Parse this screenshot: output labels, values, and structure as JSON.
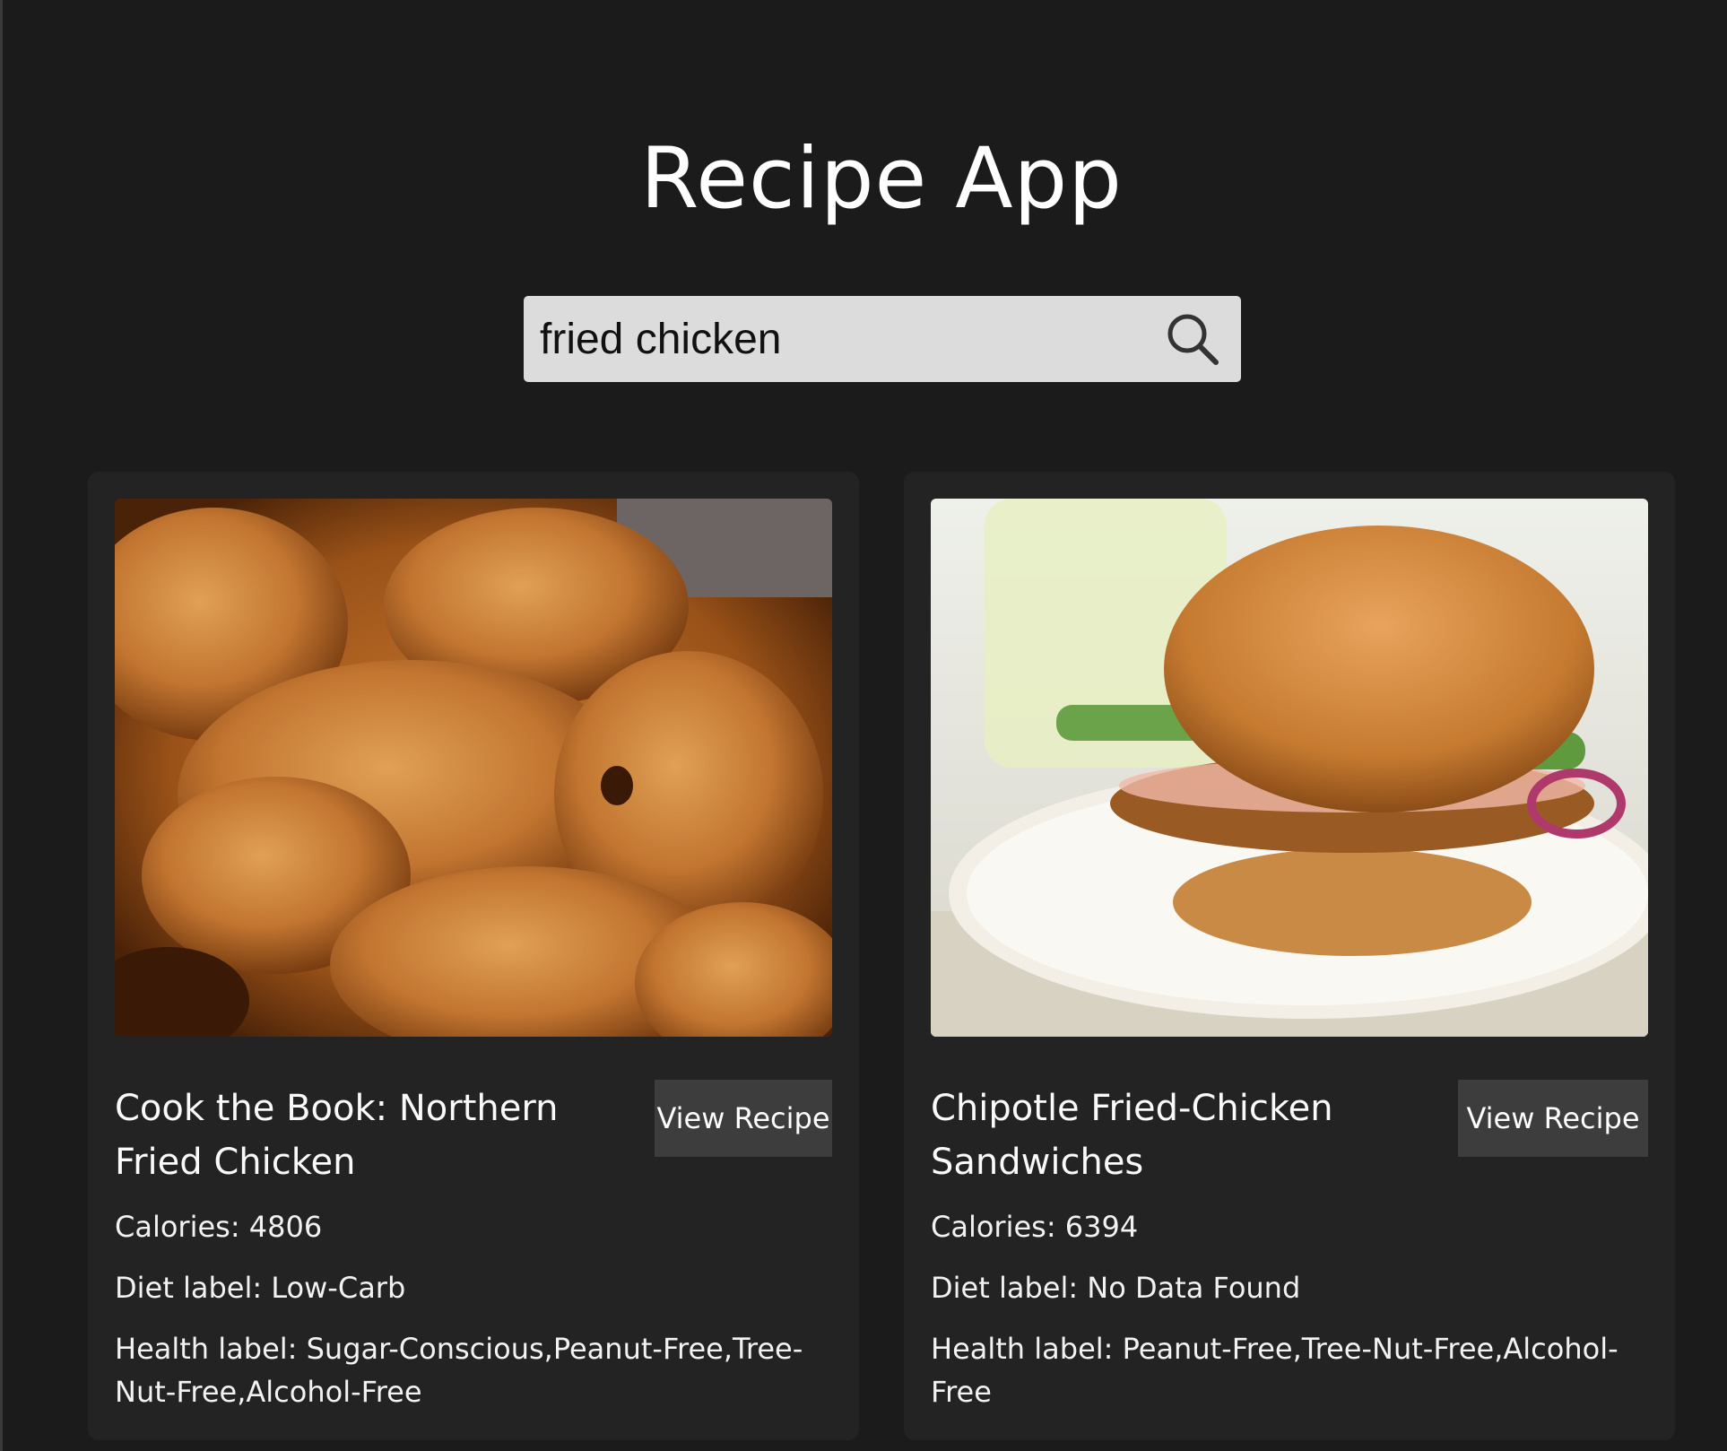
{
  "app": {
    "title": "Recipe App"
  },
  "search": {
    "value": "fried chicken",
    "icon": "search-icon"
  },
  "recipes": [
    {
      "title": "Cook the Book: Northern Fried Chicken",
      "button_label": "View Recipe",
      "calories": "Calories: 4806",
      "diet": "Diet label: Low-Carb",
      "health": "Health label: Sugar-Conscious,Peanut-Free,Tree-Nut-Free,Alcohol-Free"
    },
    {
      "title": "Chipotle Fried-Chicken Sandwiches",
      "button_label": "View Recipe",
      "calories": "Calories: 6394",
      "diet": "Diet label: No Data Found",
      "health": "Health label: Peanut-Free,Tree-Nut-Free,Alcohol-Free"
    }
  ],
  "colors": {
    "background": "#1b1b1b",
    "card": "#232323",
    "button": "#3d3d3d",
    "search_bg": "#dcdcdc"
  }
}
